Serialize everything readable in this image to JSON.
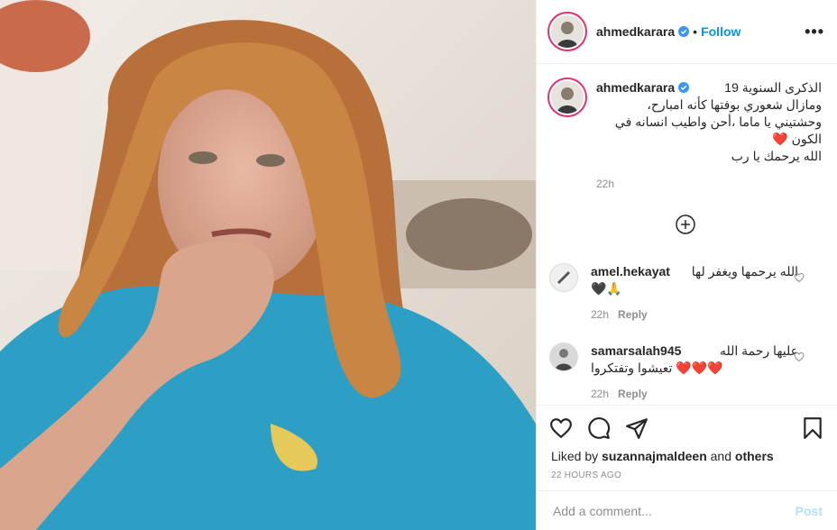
{
  "post": {
    "author": "ahmedkarara",
    "follow_label": "Follow",
    "separator": "•",
    "more_label": "•••"
  },
  "caption": {
    "username": "ahmedkarara",
    "line1": "الذكرى السنوية 19",
    "line2": "ومازال شعوري بوفتها كأنه امبارح،",
    "line3": "وحشتيني يا ماما ،أحن واطيب انسانه في",
    "line4": "الكون ❤️",
    "line5": "الله يرحمك يا رب",
    "time": "22h"
  },
  "comments": [
    {
      "username": "amel.hekayat",
      "text1": "الله يرحمها ويغفر لها",
      "text2": "🖤🙏",
      "time": "22h",
      "reply": "Reply"
    },
    {
      "username": "samarsalah945",
      "text1": "عليها رحمة الله",
      "text2": "❤️❤️❤️ تعيشوا وتفتكروا",
      "time": "22h",
      "reply": "Reply"
    }
  ],
  "likes": {
    "prefix": "Liked by",
    "user": "suzannajmaldeen",
    "and": "and",
    "others": "others"
  },
  "timestamp": "22 HOURS AGO",
  "add_comment": {
    "placeholder": "Add a comment...",
    "post_label": "Post"
  },
  "colors": {
    "accent": "#0095f6",
    "shirt": "#2d9fc4",
    "hair": "#b8703a"
  },
  "icons": [
    "verified-icon",
    "more-icon",
    "add-icon",
    "heart-icon",
    "comment-icon",
    "share-icon",
    "bookmark-icon"
  ]
}
